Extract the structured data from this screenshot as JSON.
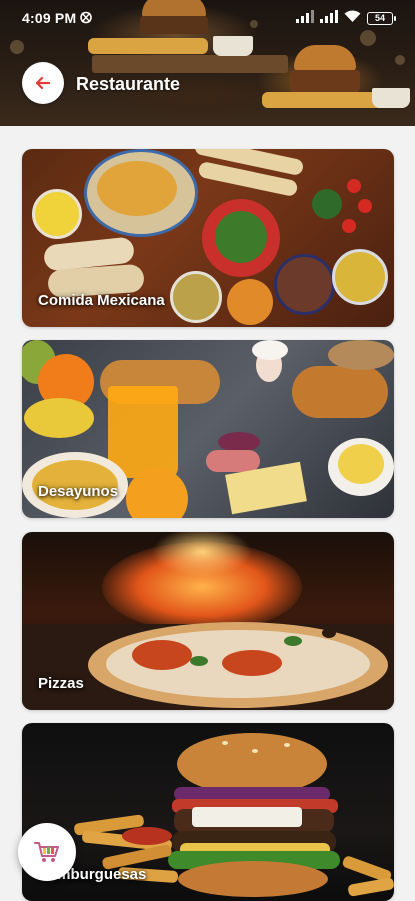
{
  "status_bar": {
    "time": "4:09 PM",
    "battery": "54"
  },
  "header": {
    "title": "Restaurante",
    "back_icon": "arrow-left-icon",
    "accent_color": "#e53935"
  },
  "categories": [
    {
      "label": "Comida Mexicana"
    },
    {
      "label": "Desayunos"
    },
    {
      "label": "Pizzas"
    },
    {
      "label": "Hamburguesas"
    }
  ],
  "cart": {
    "icon": "shopping-cart-icon"
  }
}
